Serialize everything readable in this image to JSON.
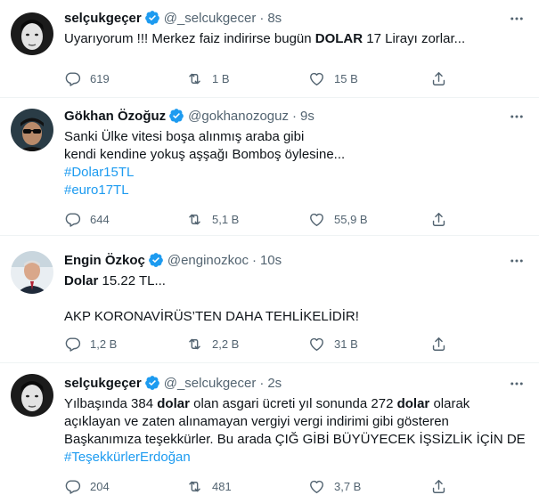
{
  "tweets": [
    {
      "name": "selçukgeçer",
      "handle": "@_selcukgecer",
      "sep": "·",
      "time": "8s",
      "lines": [
        {
          "a": "Uyarıyorum !!! Merkez faiz indirirse bugün ",
          "b": "DOLAR",
          "c": " 17 Lirayı zorlar..."
        }
      ],
      "replies": "619",
      "retweets": "1 B",
      "likes": "15 B"
    },
    {
      "name": "Gökhan Özoğuz",
      "handle": "@gokhanozoguz",
      "sep": "·",
      "time": "9s",
      "lines": [
        "Sanki Ülke vitesi boşa alınmış araba gibi",
        "kendi kendine yokuş aşşağı Bomboş öylesine..."
      ],
      "hashtags": [
        "#Dolar15TL",
        "#euro17TL"
      ],
      "replies": "644",
      "retweets": "5,1 B",
      "likes": "55,9 B"
    },
    {
      "name": "Engin Özkoç",
      "handle": "@enginozkoc",
      "sep": "·",
      "time": "10s",
      "line1_bold": "Dolar",
      "line1_rest": " 15.22 TL...",
      "line2": "AKP KORONAVİRÜS’TEN DAHA TEHLİKELİDİR!",
      "replies": "1,2 B",
      "retweets": "2,2 B",
      "likes": "31 B"
    },
    {
      "name": "selçukgeçer",
      "handle": "@_selcukgecer",
      "sep": "·",
      "time": "2s",
      "l1a": "Yılbaşında 384 ",
      "l1b": "dolar",
      "l1c": " olan asgari ücreti yıl sonunda 272 ",
      "l1d": "dolar",
      "l1e": " olarak",
      "l2": "açıklayan ve zaten alınamayan vergiyi vergi indirimi gibi gösteren",
      "l3": "Başkanımıza teşekkürler. Bu arada ÇIĞ GİBİ BÜYÜYECEK İŞSİZLİK İÇİN DE",
      "hashtag": "#TeşekkürlerErdoğan",
      "replies": "204",
      "retweets": "481",
      "likes": "3,7 B"
    }
  ],
  "icons": {
    "verified": "verified-badge-icon",
    "more": "more-options-icon",
    "reply": "reply-icon",
    "retweet": "retweet-icon",
    "like": "like-icon",
    "share": "share-icon"
  },
  "colors": {
    "link": "#1d9bf0",
    "secondary": "#536471",
    "text": "#0f1419",
    "divider": "#eff3f4"
  }
}
